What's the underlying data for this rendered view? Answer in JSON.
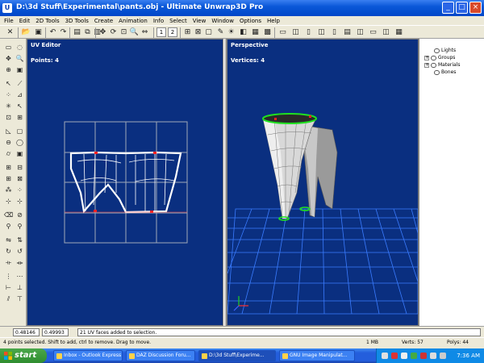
{
  "window": {
    "title": "D:\\3d Stuff\\Experimental\\pants.obj - Ultimate Unwrap3D Pro",
    "app_icon_letter": "U",
    "minimize": "_",
    "maximize": "□",
    "close": "×"
  },
  "menu": [
    "File",
    "Edit",
    "2D Tools",
    "3D Tools",
    "Create",
    "Animation",
    "Info",
    "Select",
    "View",
    "Window",
    "Options",
    "Help"
  ],
  "toolbar": {
    "view1": "1",
    "view2": "2"
  },
  "uv_editor": {
    "title": "UV Editor",
    "points_label": "Points: 4"
  },
  "perspective": {
    "title": "Perspective",
    "vertices_label": "Vertices: 4"
  },
  "scene_tree": [
    "Lights",
    "Groups",
    "Materials",
    "Bones"
  ],
  "input_bar": {
    "u_value": "0.48146",
    "v_value": "0.49993",
    "message": "21 UV faces added to selection."
  },
  "status_bar": {
    "hint": "4 points selected.  Shift to add, ctrl to remove.  Drag to move.",
    "memory": "1 MB",
    "verts": "Verts: 57",
    "polys": "Polys: 44"
  },
  "taskbar": {
    "start_label": "start",
    "items": [
      "Inbox - Outlook Express",
      "DAZ Discussion Foru...",
      "D:\\3d Stuff\\Experime...",
      "GNU Image Manipulat..."
    ],
    "clock": "7:36 AM"
  },
  "colors": {
    "viewport_bg": "#0a2f80",
    "uv_grid": "#a0a8b8",
    "uv_mesh": "#ffffff",
    "selection": "#ff2020",
    "boundary_green": "#20e020",
    "floor_grid": "#3a7cff"
  }
}
